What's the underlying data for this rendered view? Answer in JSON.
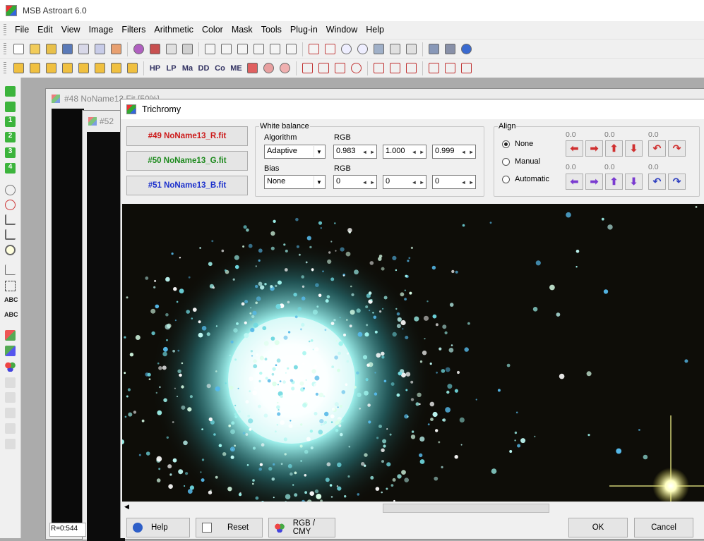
{
  "app": {
    "title": "MSB Astroart 6.0"
  },
  "menu": [
    "File",
    "Edit",
    "View",
    "Image",
    "Filters",
    "Arithmetic",
    "Color",
    "Mask",
    "Tools",
    "Plug-in",
    "Window",
    "Help"
  ],
  "toolbar2_text": [
    "HP",
    "LP",
    "Ma",
    "DD",
    "Co",
    "ME"
  ],
  "left_toolbar": {
    "digits": [
      "1",
      "2",
      "3",
      "4"
    ],
    "abc": [
      "ABC",
      "ABC"
    ]
  },
  "bg_windows": {
    "win48_title": "#48 NoName13.Fit [50%]",
    "win52_title": "#52",
    "status": "R=0:544"
  },
  "dialog": {
    "title": "Trichromy",
    "channels": [
      {
        "label": "#49 NoName13_R.fit",
        "color": "#cc1a1a"
      },
      {
        "label": "#50 NoName13_G.fit",
        "color": "#1e8a1e"
      },
      {
        "label": "#51 NoName13_B.fit",
        "color": "#1a2fcc"
      }
    ],
    "white_balance": {
      "legend": "White balance",
      "algorithm_label": "Algorithm",
      "algorithm_value": "Adaptive",
      "rgb_label": "RGB",
      "rgb_values": [
        "0.983",
        "1.000",
        "0.999"
      ],
      "bias_label": "Bias",
      "bias_value": "None",
      "bias_rgb_label": "RGB",
      "bias_rgb_values": [
        "0",
        "0",
        "0"
      ]
    },
    "align": {
      "legend": "Align",
      "options": [
        {
          "label": "None",
          "selected": true
        },
        {
          "label": "Manual",
          "selected": false
        },
        {
          "label": "Automatic",
          "selected": false
        }
      ],
      "row1_values": [
        "0.0",
        "0.0",
        "0.0"
      ],
      "row2_values": [
        "0.0",
        "0.0",
        "0.0"
      ]
    },
    "buttons": {
      "help": "Help",
      "reset": "Reset",
      "rgbcmy": "RGB / CMY",
      "ok": "OK",
      "cancel": "Cancel"
    }
  }
}
